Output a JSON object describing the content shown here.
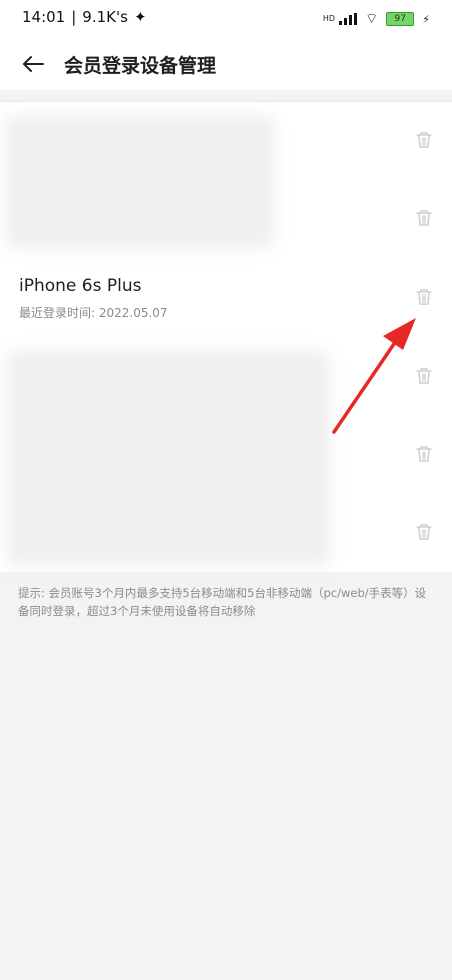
{
  "status": {
    "time": "14:01",
    "speed": "9.1K's",
    "network": "HD",
    "battery": "97"
  },
  "header": {
    "title": "会员登录设备管理"
  },
  "devices": {
    "name": "iPhone 6s Plus",
    "last_login": "最近登录时间: 2022.05.07"
  },
  "hint": "提示: 会员账号3个月内最多支持5台移动端和5台非移动端（pc/web/手表等）设备同时登录，超过3个月未使用设备将自动移除",
  "icons": {
    "back": "arrow-left-icon",
    "trash": "trash-icon"
  },
  "colors": {
    "annotation": "#e52a24",
    "battery": "#77d46b"
  }
}
